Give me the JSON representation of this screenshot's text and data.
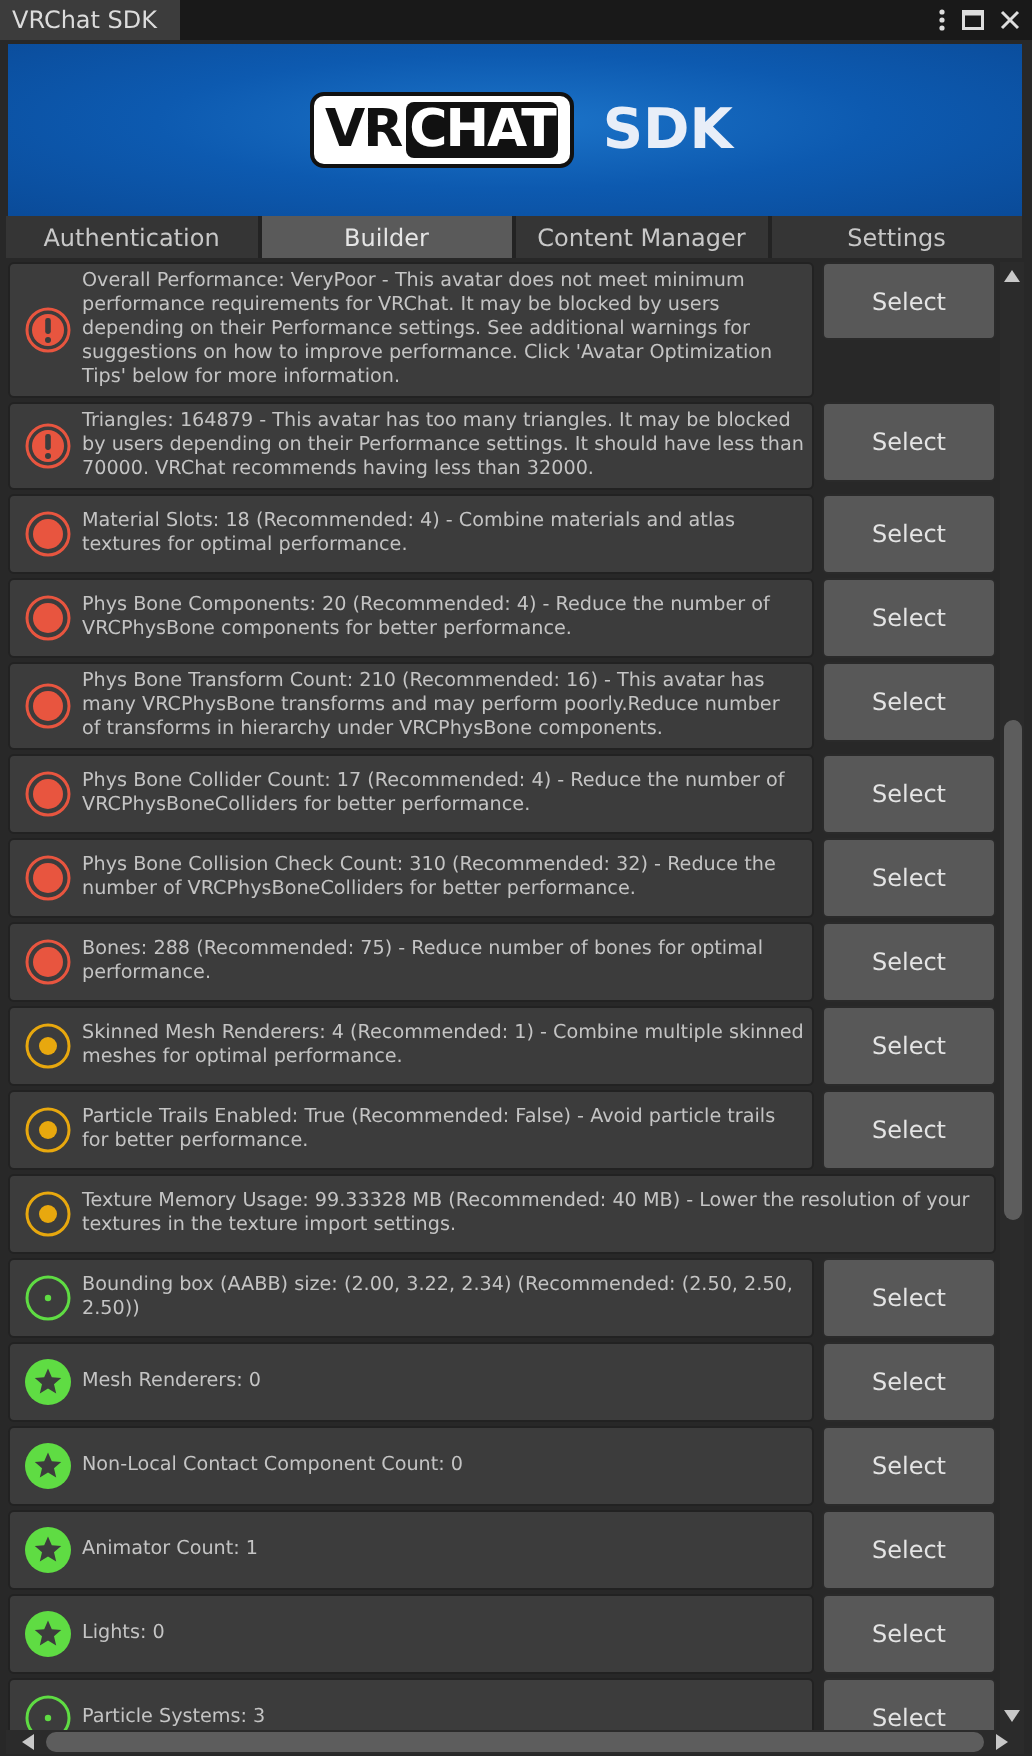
{
  "window": {
    "title": "VRChat SDK"
  },
  "banner": {
    "logo_left": "VR",
    "logo_right": "CHAT",
    "suffix": "SDK"
  },
  "tabs": [
    {
      "label": "Authentication",
      "selected": false
    },
    {
      "label": "Builder",
      "selected": true
    },
    {
      "label": "Content Manager",
      "selected": false
    },
    {
      "label": "Settings",
      "selected": false
    }
  ],
  "messages": [
    {
      "kind": "error",
      "text": "Overall Performance: VeryPoor - This avatar does not meet minimum performance requirements for VRChat. It may be blocked by users depending on their Performance settings. See additional warnings for suggestions on how to improve performance. Click 'Avatar Optimization Tips' below for more information.",
      "button": "Select"
    },
    {
      "kind": "error",
      "text": "Triangles: 164879 - This avatar has too many triangles. It may be blocked by users depending on their Performance settings. It should have less than 70000. VRChat recommends having less than 32000.",
      "button": "Select"
    },
    {
      "kind": "very_poor",
      "text": "Material Slots: 18 (Recommended: 4) - Combine materials and atlas textures for optimal performance.",
      "button": "Select"
    },
    {
      "kind": "very_poor",
      "text": "Phys Bone Components: 20 (Recommended: 4) - Reduce the number of VRCPhysBone components for better performance.",
      "button": "Select"
    },
    {
      "kind": "very_poor",
      "text": "Phys Bone Transform Count: 210 (Recommended: 16) - This avatar has many VRCPhysBone transforms and may perform poorly.Reduce number of transforms in hierarchy under VRCPhysBone components.",
      "button": "Select"
    },
    {
      "kind": "very_poor",
      "text": "Phys Bone Collider Count: 17 (Recommended: 4) - Reduce the number of VRCPhysBoneColliders for better performance.",
      "button": "Select"
    },
    {
      "kind": "very_poor",
      "text": "Phys Bone Collision Check Count: 310 (Recommended: 32) - Reduce the number of VRCPhysBoneColliders for better performance.",
      "button": "Select"
    },
    {
      "kind": "very_poor",
      "text": "Bones: 288 (Recommended: 75) - Reduce number of bones for optimal performance.",
      "button": "Select"
    },
    {
      "kind": "medium",
      "text": "Skinned Mesh Renderers: 4 (Recommended: 1) - Combine multiple skinned meshes for optimal performance.",
      "button": "Select"
    },
    {
      "kind": "medium",
      "text": "Particle Trails Enabled: True (Recommended: False) - Avoid particle trails for better performance.",
      "button": "Select"
    },
    {
      "kind": "medium",
      "text": "Texture Memory Usage: 99.33328 MB (Recommended: 40 MB) - Lower the resolution of your textures in the texture import settings."
    },
    {
      "kind": "good",
      "text": "Bounding box (AABB) size: (2.00, 3.22, 2.34) (Recommended: (2.50, 2.50, 2.50))",
      "button": "Select"
    },
    {
      "kind": "excellent",
      "text": "Mesh Renderers: 0",
      "button": "Select"
    },
    {
      "kind": "excellent",
      "text": "Non-Local Contact Component Count: 0",
      "button": "Select"
    },
    {
      "kind": "excellent",
      "text": "Animator Count: 1",
      "button": "Select"
    },
    {
      "kind": "excellent",
      "text": "Lights: 0",
      "button": "Select"
    },
    {
      "kind": "good",
      "text": "Particle Systems: 3",
      "button": "Select"
    }
  ]
}
